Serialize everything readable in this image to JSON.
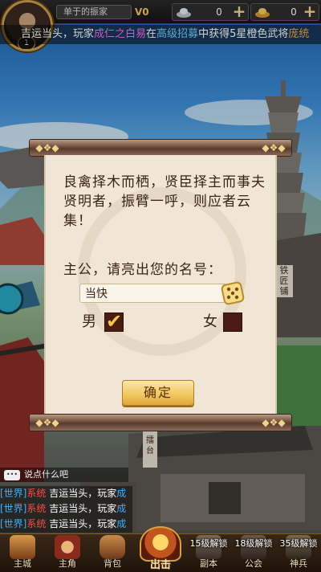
{
  "player": {
    "name": "单于的振家",
    "level": "1",
    "vip": "V0"
  },
  "resources": [
    {
      "icon": "silver-ingot-icon",
      "value": "0"
    },
    {
      "icon": "gold-ingot-icon",
      "value": "0"
    }
  ],
  "announcement": {
    "prefix": "吉运当头，玩家",
    "player": "成仁之白易",
    "mid": "在",
    "place": "高级招募",
    "suffix": "中获得5星橙色武将",
    "hero": "庞统"
  },
  "map_labels": {
    "blacksmith": "铁匠铺",
    "arena": "擂台"
  },
  "dialog": {
    "intro": "良禽择木而栖，贤臣择主而事夫贤明者，振臂一呼，则应者云集！",
    "prompt": "主公，请亮出您的名号：",
    "name_value": "当快",
    "male_label": "男",
    "female_label": "女",
    "male_checked": true,
    "female_checked": false,
    "confirm_label": "确定"
  },
  "chat": {
    "placeholder": "说点什么吧",
    "lines": [
      {
        "tag": "[世界]",
        "channel": "系统",
        "text": "吉运当头，玩家",
        "tail": "成"
      },
      {
        "tag": "[世界]",
        "channel": "系统",
        "text": "吉运当头，玩家",
        "tail": "成"
      },
      {
        "tag": "[世界]",
        "channel": "系统",
        "text": "吉运当头，玩家",
        "tail": "成"
      }
    ]
  },
  "nav": {
    "items": [
      {
        "label": "主城",
        "lock": ""
      },
      {
        "label": "主角",
        "lock": ""
      },
      {
        "label": "背包",
        "lock": ""
      },
      {
        "label": "出击",
        "lock": ""
      },
      {
        "label": "副本",
        "lock": "15级解锁"
      },
      {
        "label": "公会",
        "lock": "18级解锁"
      },
      {
        "label": "神兵",
        "lock": "35级解锁"
      }
    ]
  },
  "colors": {
    "accent_gold": "#f2c862",
    "dialog_bg": "#f1e6d5",
    "checkbox_bg": "#4a1c14",
    "system_red": "#ff4a3a",
    "player_blue": "#3ab0ff"
  }
}
